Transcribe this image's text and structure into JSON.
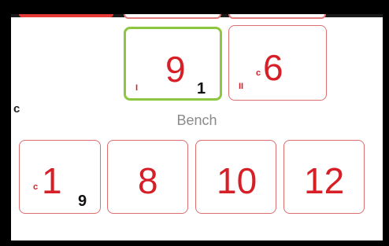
{
  "top_row": {
    "cards": [
      {
        "number": "9",
        "mark": "I",
        "count": "1",
        "selected": true
      },
      {
        "number": "6",
        "mark": "II",
        "prefix": "c",
        "count": "",
        "selected": false
      }
    ]
  },
  "bench": {
    "label": "Bench",
    "cards": [
      {
        "number": "1",
        "prefix": "c",
        "count": "9"
      },
      {
        "number": "8"
      },
      {
        "number": "10"
      },
      {
        "number": "12"
      }
    ]
  },
  "colors": {
    "card_border": "#e06d6d",
    "number_red": "#d61f26",
    "selected_border": "#8dc63f",
    "label_gray": "#8a8a8a"
  },
  "edge_glyph": "c"
}
